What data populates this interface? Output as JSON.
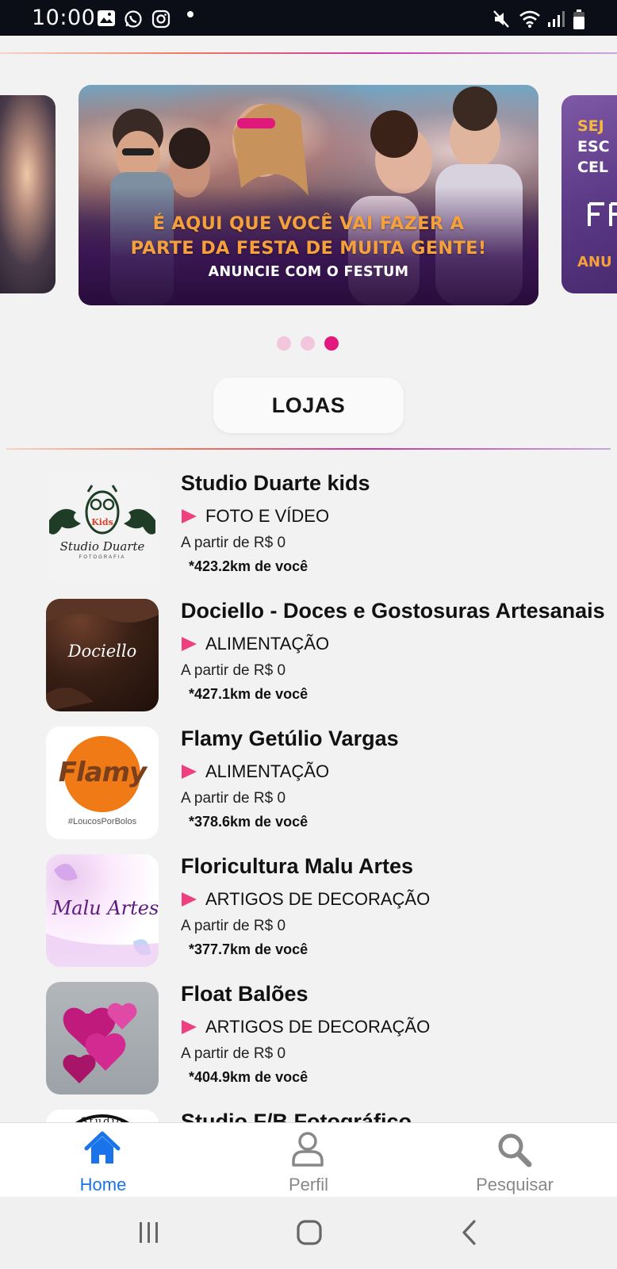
{
  "status_bar": {
    "time": "10:00"
  },
  "carousel": {
    "main_banner": {
      "headline_line1": "É AQUI QUE VOCÊ VAI FAZER A",
      "headline_line2": "PARTE DA FESTA DE MUITA GENTE!",
      "subtitle": "ANUNCIE COM O FESTUM"
    },
    "right_banner": {
      "line1": "SEJ",
      "line2": "ESC",
      "line3": "CEL",
      "bottom": "ANU"
    },
    "page_count": 3,
    "active_page": 3
  },
  "section": {
    "title": "LOJAS"
  },
  "stores": [
    {
      "name": "Studio Duarte kids",
      "category": "FOTO E VÍDEO",
      "price": "A partir de R$ 0",
      "distance": "*423.2km de você",
      "logo_text": "Studio Duarte",
      "logo_sub": "FOTOGRAFIA",
      "logo_badge": "Kids"
    },
    {
      "name": "Dociello - Doces e Gostosuras Artesanais",
      "category": "ALIMENTAÇÃO",
      "price": "A partir de R$ 0",
      "distance": "*427.1km de você",
      "logo_text": "Dociello"
    },
    {
      "name": "Flamy Getúlio Vargas",
      "category": "ALIMENTAÇÃO",
      "price": "A partir de R$ 0",
      "distance": "*378.6km de você",
      "logo_text": "Flamy",
      "logo_sub": "#LoucosPorBolos"
    },
    {
      "name": "Floricultura Malu Artes",
      "category": "ARTIGOS DE DECORAÇÃO",
      "price": "A partir de R$ 0",
      "distance": "*377.7km de você",
      "logo_text": "Malu Artes"
    },
    {
      "name": "Float Balões",
      "category": "ARTIGOS DE DECORAÇÃO",
      "price": "A partir de R$ 0",
      "distance": "*404.9km de você"
    },
    {
      "name": "Studio F/B Fotográfico",
      "logo_text": "Studio"
    }
  ],
  "bottom_nav": {
    "items": [
      {
        "label": "Home",
        "icon": "home-icon",
        "active": true
      },
      {
        "label": "Perfil",
        "icon": "user-icon",
        "active": false
      },
      {
        "label": "Pesquisar",
        "icon": "search-icon",
        "active": false
      }
    ]
  },
  "colors": {
    "accent": "#e2187c",
    "nav_active": "#1a73e8",
    "category_marker": "#ef3f7e"
  }
}
